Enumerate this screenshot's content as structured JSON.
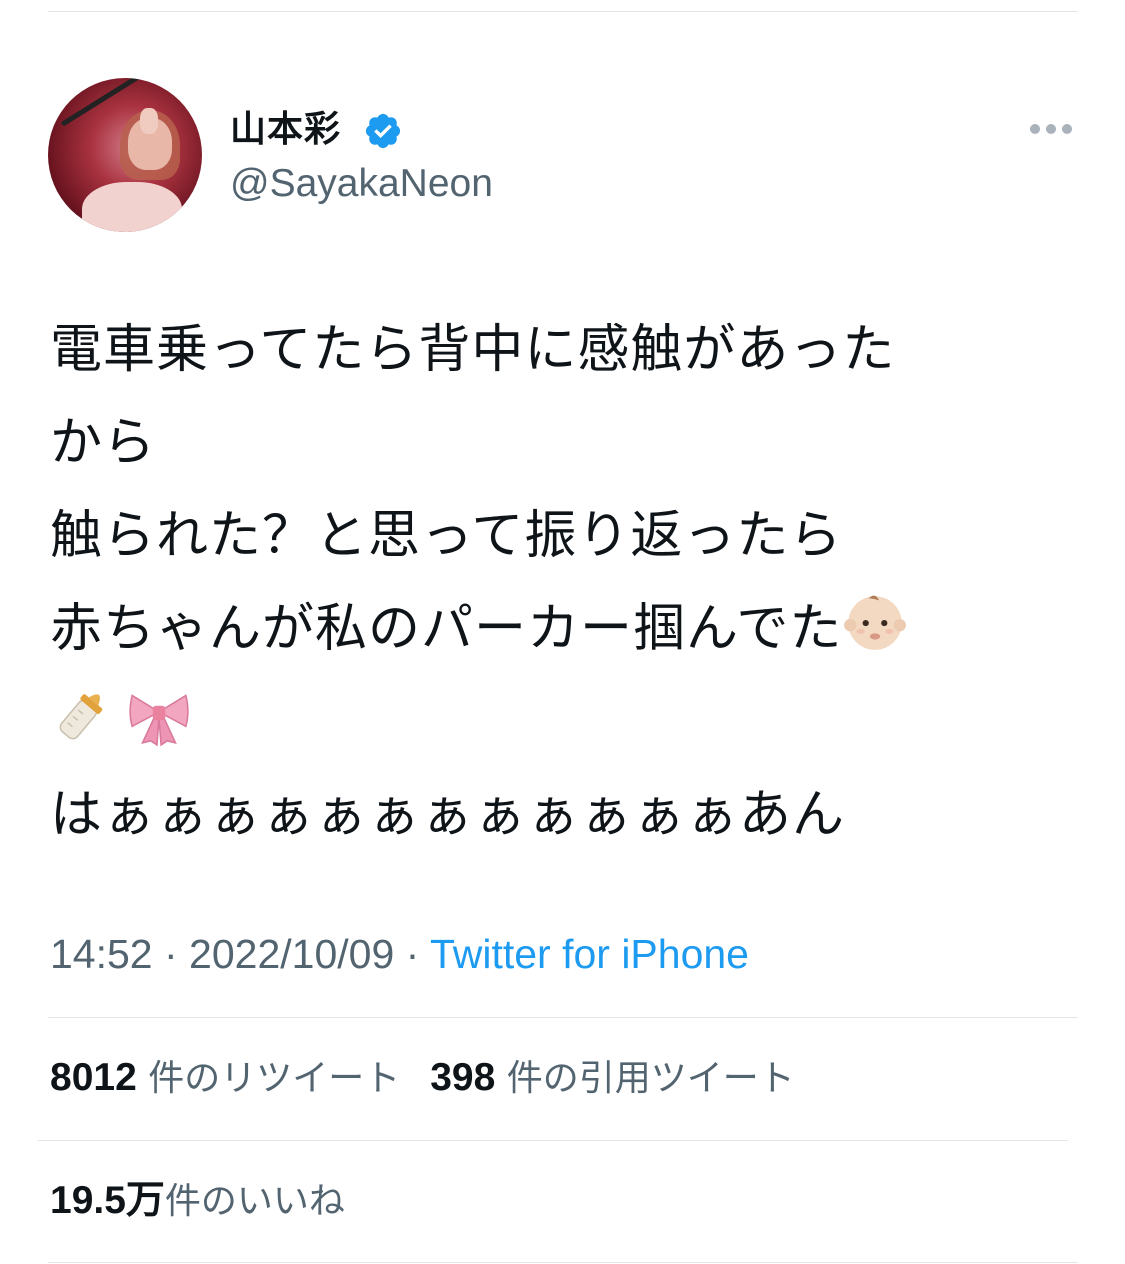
{
  "author": {
    "name": "山本彩",
    "handle": "@SayakaNeon"
  },
  "tweet": {
    "lines": [
      "電車乗ってたら背中に感触があった",
      "から",
      "触られた？と思って振り返ったら",
      "赤ちゃんが私のパーカー掴んでた",
      "",
      "はぁぁぁぁぁぁぁぁぁぁぁぁあん"
    ],
    "emoji": [
      "baby-icon",
      "baby-bottle-icon",
      "ribbon-icon"
    ]
  },
  "meta": {
    "time": "14:52",
    "separator": " · ",
    "date": "2022/10/09",
    "source": "Twitter for iPhone"
  },
  "stats": {
    "retweets_count": "8012",
    "retweets_label": "件のリツイート",
    "quotes_count": "398",
    "quotes_label": "件の引用ツイート",
    "likes_count": "19.5万",
    "likes_label": "件のいいね"
  },
  "colors": {
    "text": "#0f1419",
    "secondary": "#536471",
    "link": "#1d9bf0",
    "verified": "#1d9bf0",
    "divider": "#e1e6ea"
  }
}
